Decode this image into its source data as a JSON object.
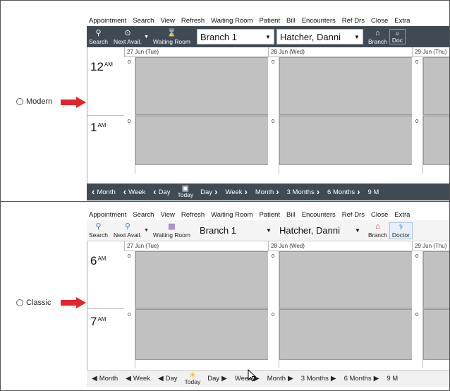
{
  "options": {
    "modern_label": "Modern",
    "classic_label": "Classic"
  },
  "menu": [
    "Appointment",
    "Search",
    "View",
    "Refresh",
    "Waiting Room",
    "Patient",
    "Bill",
    "Encounters",
    "Ref Drs",
    "Close",
    "Extra"
  ],
  "toolbar": {
    "search_label": "Search",
    "next_avail_label": "Next Avail.",
    "waiting_room_label": "Waiting Room",
    "branch_value": "Branch 1",
    "doctor_value": "Hatcher, Danni",
    "branch_btn_label": "Branch",
    "doctor_btn_label": "Doctor",
    "doctor_btn_label_truncated": "Doc"
  },
  "days": [
    "27 Jun (Tue)",
    "28 Jun (Wed)",
    "29 Jun (Thu)"
  ],
  "modern": {
    "hours": [
      {
        "hour": "12",
        "ampm": "AM"
      },
      {
        "hour": "1",
        "ampm": "AM"
      }
    ],
    "slot_count": "0"
  },
  "classic": {
    "hours": [
      {
        "hour": "6",
        "ampm": "AM"
      },
      {
        "hour": "7",
        "ampm": "AM"
      }
    ],
    "slot_count": "0"
  },
  "nav": {
    "month": "Month",
    "week": "Week",
    "day": "Day",
    "today": "Today",
    "three_months": "3 Months",
    "six_months": "6 Months",
    "nine_months_truncated": "9 M"
  },
  "icons": {
    "search": "search-icon",
    "next_avail": "next-avail-icon",
    "waiting_room": "waiting-room-icon",
    "branch": "branch-icon",
    "doctor": "doctor-icon",
    "today": "calendar-today-icon",
    "arrow": "red-arrow-icon"
  },
  "colors": {
    "dark_toolbar": "#3f4a55",
    "slot_fill": "#c1c1c1",
    "arrow_red": "#e0262b",
    "light_toolbar": "#f4f4f4"
  }
}
